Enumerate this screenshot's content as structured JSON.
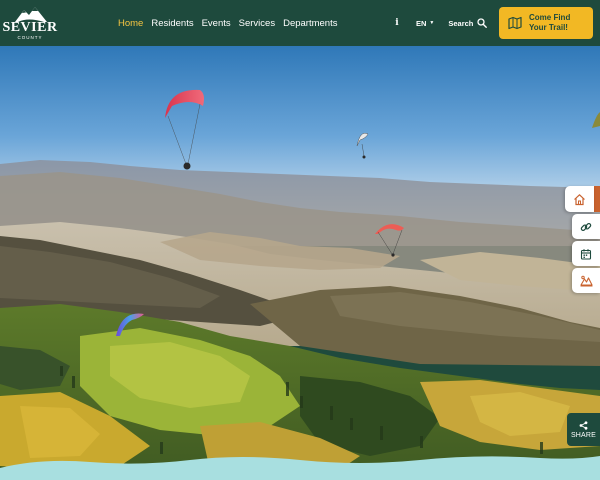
{
  "brand": {
    "name": "SEVIER",
    "subtitle": "COUNTY"
  },
  "nav": {
    "items": [
      {
        "label": "Home",
        "active": true
      },
      {
        "label": "Residents",
        "active": false
      },
      {
        "label": "Events",
        "active": false
      },
      {
        "label": "Services",
        "active": false
      },
      {
        "label": "Departments",
        "active": false
      }
    ]
  },
  "utility": {
    "info_icon": "i",
    "language": "EN",
    "search_label": "Search"
  },
  "cta": {
    "label": "Come Find Your Trail!",
    "icon": "map-icon"
  },
  "side_rail": {
    "buttons": [
      {
        "icon": "home-icon"
      },
      {
        "icon": "link-icon"
      },
      {
        "icon": "calendar-icon"
      },
      {
        "icon": "parks-icon"
      }
    ]
  },
  "share": {
    "label": "SHARE",
    "icon": "share-icon"
  },
  "hero": {
    "image": "paragliders-over-autumn-aspen-valley"
  },
  "colors": {
    "header_bg": "#1e4a3d",
    "nav_active": "#f5c542",
    "cta_bg": "#f2b824",
    "accent_orange": "#c9622e",
    "bottom_wave": "#a8dfe0"
  }
}
